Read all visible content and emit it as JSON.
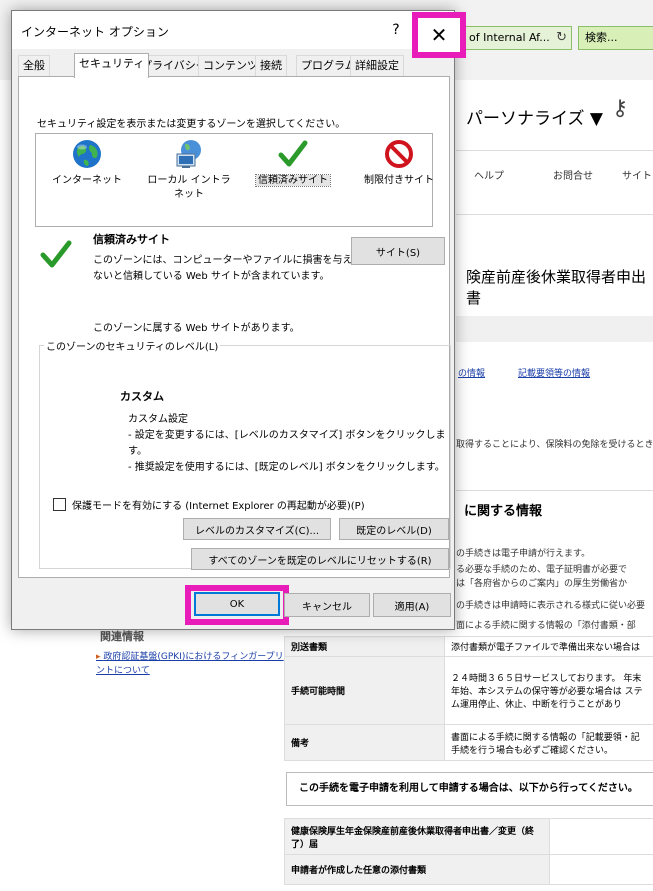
{
  "browser": {
    "address_text": "y of Internal Af...",
    "search_placeholder": "検索...",
    "personalize_label": "パーソナライズ ▼",
    "nav_items": [
      "ヘルプ",
      "お問合せ",
      "サイト"
    ],
    "page_title": "険産前産後休業取得者申出書",
    "links": [
      "の情報",
      "記載要領等の情報"
    ],
    "text_lines": [
      "取得することにより、保険料の免除を受けるとき",
      "の手続きは電子申請が行えます。",
      "る必要な手続のため、電子証明書が必要で",
      "は「各府省からのご案内」の厚生労働省か",
      "の手続きは申請時に表示される様式に従い必要",
      "面による手続に関する情報の「添付書類・部"
    ],
    "section_title": "に関する情報",
    "left_title": "関連情報",
    "left_link": "政府認証基盤(GPKI)におけるフィンガープリントについて",
    "table_rows": [
      {
        "header": "別送書類",
        "value": "添付書類が電子ファイルで準備出来ない場合は"
      },
      {
        "header": "手続可能時間",
        "value": "２４時間３６５日サービスしております。 年末年始、本システムの保守等が必要な場合は ステム運用停止、休止、中断を行うことがあり"
      },
      {
        "header": "備考",
        "value": "書面による手続に関する情報の「記載要領・記 手続を行う場合も必ずご確認ください。"
      }
    ],
    "banner_text": "この手続を電子申請を利用して申請する場合は、以下から行ってください。",
    "table2_rows": [
      {
        "header": "健康保険厚生年金保険産前産後休業取得者申出書／変更（終了）届"
      },
      {
        "header": "申請者が作成した任意の添付書類"
      }
    ]
  },
  "dialog": {
    "title": "インターネット オプション",
    "help_label": "?",
    "close_label": "✕",
    "tabs": [
      "全般",
      "セキュリティ",
      "プライバシー",
      "コンテンツ",
      "接続",
      "プログラム",
      "詳細設定"
    ],
    "active_tab": "セキュリティ",
    "prompt": "セキュリティ設定を表示または変更するゾーンを選択してください。",
    "zones": [
      {
        "label": "インターネット",
        "icon": "globe-icon"
      },
      {
        "label": "ローカル イントラネット",
        "icon": "intranet-icon"
      },
      {
        "label": "信頼済みサイト",
        "icon": "checkmark-icon"
      },
      {
        "label": "制限付きサイト",
        "icon": "restricted-icon"
      }
    ],
    "selected_zone_name": "信頼済みサイト",
    "zone_description": "このゾーンには、コンピューターやファイルに損害を与えないと信頼している Web サイトが含まれています。",
    "sites_button": "サイト(S)",
    "zone_status": "このゾーンに属する Web サイトがあります。",
    "level_legend": "このゾーンのセキュリティのレベル(L)",
    "custom_title": "カスタム",
    "custom_lines": [
      "カスタム設定",
      "- 設定を変更するには、[レベルのカスタマイズ] ボタンをクリックします。",
      "- 推奨設定を使用するには、[既定のレベル] ボタンをクリックします。"
    ],
    "protected_mode_label": "保護モードを有効にする (Internet Explorer の再起動が必要)(P)",
    "protected_mode_checked": false,
    "customize_button": "レベルのカスタマイズ(C)...",
    "default_level_button": "既定のレベル(D)",
    "reset_all_button": "すべてのゾーンを既定のレベルにリセットする(R)",
    "ok_button": "OK",
    "cancel_button": "キャンセル",
    "apply_button": "適用(A)"
  },
  "colors": {
    "highlight": "#e81cb8",
    "link": "#1a3ea8",
    "check_green": "#2a9a2a",
    "restricted_red": "#d0141e"
  }
}
